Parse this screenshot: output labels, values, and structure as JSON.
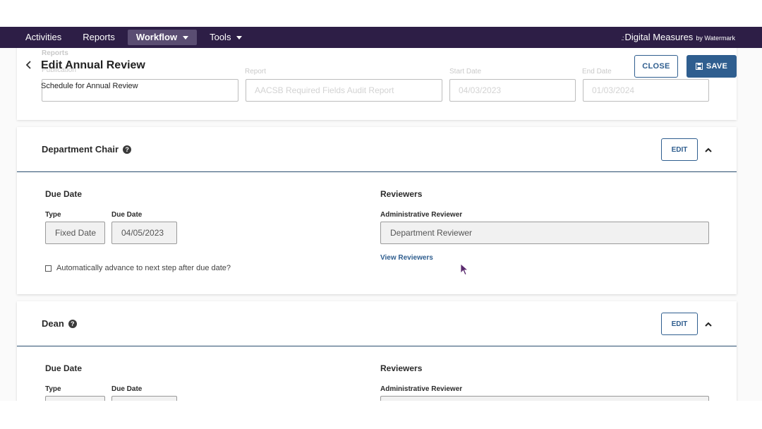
{
  "nav": {
    "items": [
      {
        "label": "Activities",
        "has_caret": false,
        "active": false
      },
      {
        "label": "Reports",
        "has_caret": false,
        "active": false
      },
      {
        "label": "Workflow",
        "has_caret": true,
        "active": true
      },
      {
        "label": "Tools",
        "has_caret": true,
        "active": false
      }
    ],
    "brand": "Digital Measures",
    "brand_suffix": "by Watermark"
  },
  "background": {
    "reports_label": "Reports",
    "publish_label": "Publication",
    "report_label": "Report",
    "report_value": "AACSB Required Fields Audit Report",
    "start_date_label": "Start Date",
    "start_date_value": "04/03/2023",
    "end_date_label": "End Date",
    "end_date_value": "01/03/2024"
  },
  "header": {
    "title": "Edit Annual Review",
    "subtitle": "Schedule for Annual Review",
    "close_label": "CLOSE",
    "save_label": "SAVE"
  },
  "steps": [
    {
      "title": "Department Chair",
      "edit_label": "EDIT",
      "due_date_heading": "Due Date",
      "type_label": "Type",
      "type_value": "Fixed Date",
      "due_date_label": "Due Date",
      "due_date_value": "04/05/2023",
      "auto_advance_label": "Automatically advance to next step after due date?",
      "reviewers_heading": "Reviewers",
      "admin_reviewer_label": "Administrative Reviewer",
      "admin_reviewer_value": "Department Reviewer",
      "view_reviewers_label": "View Reviewers"
    },
    {
      "title": "Dean",
      "edit_label": "EDIT",
      "due_date_heading": "Due Date",
      "type_label": "Type",
      "due_date_label": "Due Date",
      "reviewers_heading": "Reviewers",
      "admin_reviewer_label": "Administrative Reviewer"
    }
  ],
  "colors": {
    "nav_bg": "#2d1e46",
    "primary": "#2f5e8f",
    "cursor": "#5a2a6e"
  }
}
